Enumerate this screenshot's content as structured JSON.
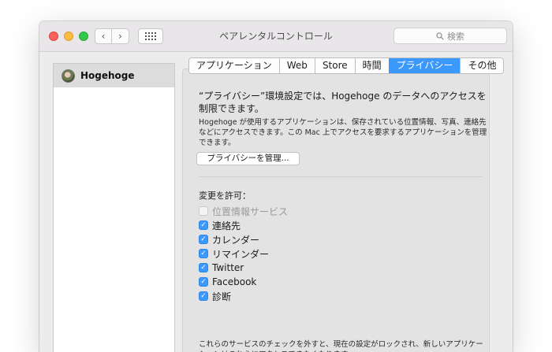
{
  "window": {
    "title": "ペアレンタルコントロール",
    "search_placeholder": "検索"
  },
  "sidebar": {
    "user_name": "Hogehoge"
  },
  "tabs": [
    {
      "label": "アプリケーション"
    },
    {
      "label": "Web"
    },
    {
      "label": "Store"
    },
    {
      "label": "時間"
    },
    {
      "label": "プライバシー"
    },
    {
      "label": "その他"
    }
  ],
  "active_tab": "プライバシー",
  "privacy": {
    "heading": "“プライバシー”環境設定では、Hogehoge のデータへのアクセスを制限できます。",
    "description": "Hogehoge が使用するアプリケーションは、保存されている位置情報、写真、連絡先などにアクセスできます。この Mac 上でアクセスを要求するアプリケーションを管理できます。",
    "manage_button": "プライバシーを管理...",
    "allow_label": "変更を許可：",
    "permissions": [
      {
        "label": "位置情報サービス",
        "checked": false,
        "enabled": false
      },
      {
        "label": "連絡先",
        "checked": true,
        "enabled": true
      },
      {
        "label": "カレンダー",
        "checked": true,
        "enabled": true
      },
      {
        "label": "リマインダー",
        "checked": true,
        "enabled": true
      },
      {
        "label": "Twitter",
        "checked": true,
        "enabled": true
      },
      {
        "label": "Facebook",
        "checked": true,
        "enabled": true
      },
      {
        "label": "診断",
        "checked": true,
        "enabled": true
      }
    ],
    "footer": "これらのサービスのチェックを外すと、現在の設定がロックされ、新しいアプリケーションはこれらにアクセスできなくなります。"
  },
  "colors": {
    "accent": "#3b98fc",
    "close": "#fc605c",
    "minimize": "#fdbc40",
    "maximize": "#34c84a"
  }
}
